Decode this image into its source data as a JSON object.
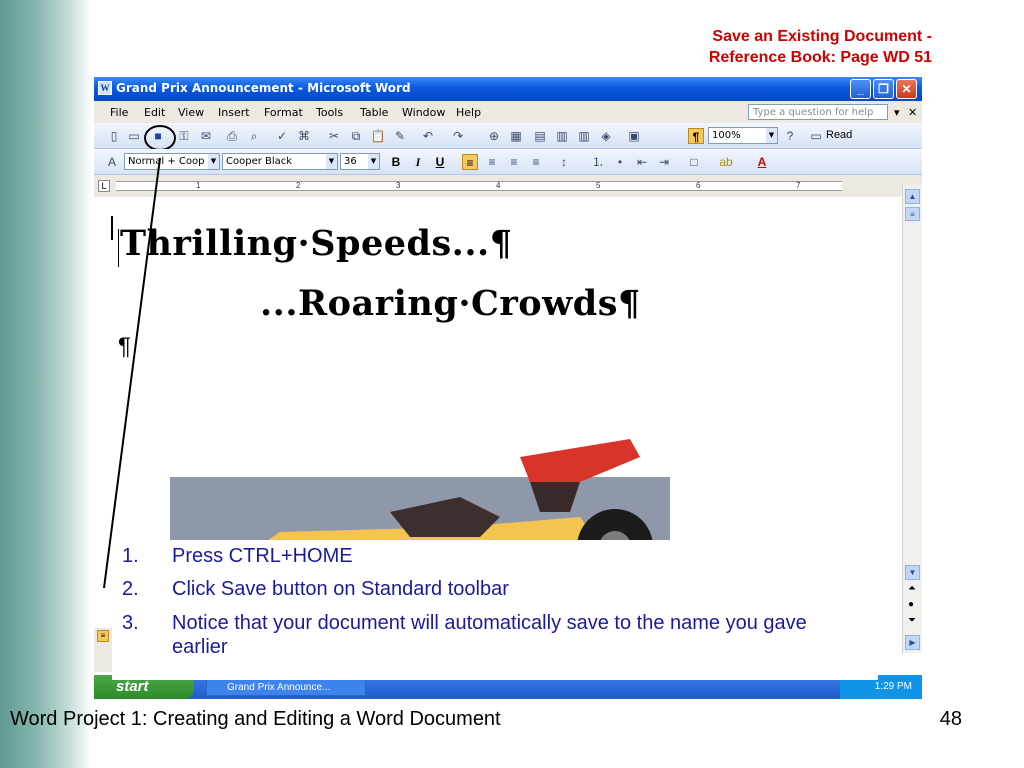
{
  "slide": {
    "title": "Save an Existing Document -\nReference Book:  Page WD 51",
    "footer": "Word Project 1: Creating and Editing a Word Document",
    "page_number": "48"
  },
  "window": {
    "title": "Grand Prix Announcement - Microsoft Word",
    "minimize": "_",
    "restore": "❐",
    "close": "✕"
  },
  "menu": {
    "items": [
      "File",
      "Edit",
      "View",
      "Insert",
      "Format",
      "Tools",
      "Table",
      "Window",
      "Help"
    ],
    "help_placeholder": "Type a question for help"
  },
  "standard_toolbar": {
    "zoom": "100%",
    "read_label": "Read"
  },
  "formatting_toolbar": {
    "style": "Normal + Coop",
    "font": "Cooper Black",
    "size": "36",
    "bold": "B",
    "italic": "I",
    "underline": "U"
  },
  "ruler": {
    "marks": [
      "1",
      "2",
      "3",
      "4",
      "5",
      "6",
      "7"
    ]
  },
  "document": {
    "line1": "Thrilling·Speeds...¶",
    "line2": "...Roaring·Crowds¶",
    "para_mark": "¶"
  },
  "steps": [
    {
      "num": "1.",
      "text": "Press CTRL+HOME"
    },
    {
      "num": "2.",
      "text": "Click Save button on Standard toolbar"
    },
    {
      "num": "3.",
      "text": "Notice that your document will automatically save to the name you gave earlier"
    }
  ],
  "taskbar": {
    "start": "start",
    "task": "Grand Prix Announce...",
    "clock": "1:29 PM"
  },
  "colors": {
    "title_red": "#cc0000",
    "steps_blue": "#1b1b9a",
    "xp_blue": "#0a5ae0"
  }
}
